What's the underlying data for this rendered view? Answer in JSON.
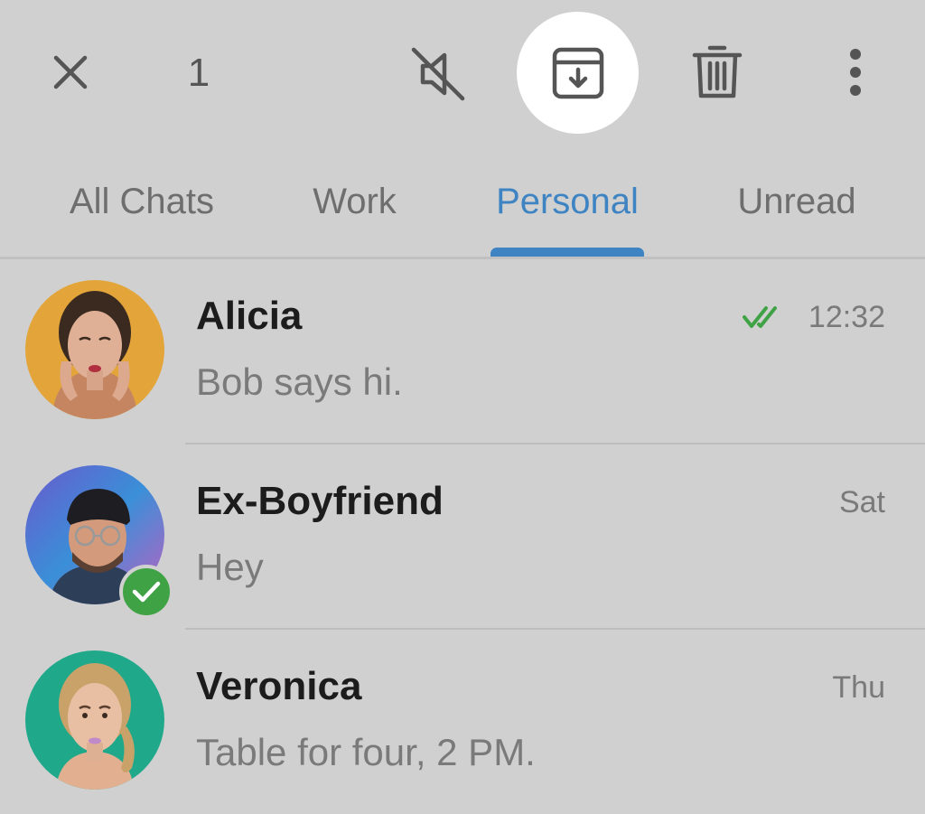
{
  "selection_bar": {
    "selected_count": "1",
    "icons": {
      "close": "close-icon",
      "mute": "mute-icon",
      "archive": "archive-icon",
      "delete": "trash-icon",
      "more": "more-vertical-icon"
    }
  },
  "tabs": [
    {
      "label": "All Chats",
      "active": false
    },
    {
      "label": "Work",
      "active": false
    },
    {
      "label": "Personal",
      "active": true
    },
    {
      "label": "Unread",
      "active": false
    }
  ],
  "chats": [
    {
      "name": "Alicia",
      "preview": "Bob says hi.",
      "time": "12:32",
      "read_receipt": "double-check-icon",
      "selected": false
    },
    {
      "name": "Ex-Boyfriend",
      "preview": "Hey",
      "time": "Sat",
      "selected": true
    },
    {
      "name": "Veronica",
      "preview": "Table for four, 2 PM.",
      "time": "Thu",
      "selected": false
    }
  ],
  "colors": {
    "background": "#d0d0d0",
    "accent": "#3e84c3",
    "selected_badge": "#3fa345",
    "read_check": "#3fa345"
  }
}
